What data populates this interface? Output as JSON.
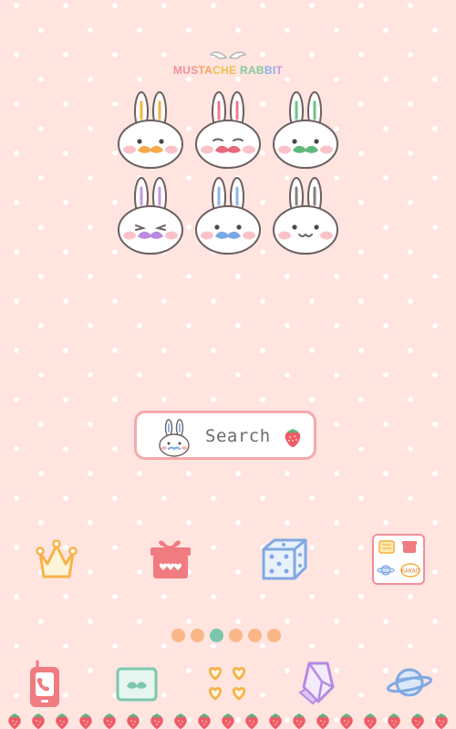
{
  "logo": {
    "title_letters": [
      "MUS",
      "TA",
      "CHE ",
      "RAB",
      "BI",
      "T"
    ]
  },
  "rabbits": [
    {
      "name": "rabbit-orange-mustache",
      "ear_color": "#f5b34a",
      "mustache": "#f5a94a"
    },
    {
      "name": "rabbit-red-mustache",
      "ear_color": "#f07b8c",
      "mustache": "#e8697a"
    },
    {
      "name": "rabbit-green-mustache",
      "ear_color": "#6fc28b",
      "mustache": "#5fb87c"
    },
    {
      "name": "rabbit-purple-mustache",
      "ear_color": "#c39ae6",
      "mustache": "#b98ae0"
    },
    {
      "name": "rabbit-blue-mustache",
      "ear_color": "#8db6ea",
      "mustache": "#7aa8e6"
    },
    {
      "name": "rabbit-plain",
      "ear_color": "#8a7f7d",
      "mustache": "none"
    }
  ],
  "search": {
    "label": "Search"
  },
  "dock": [
    "crown-icon",
    "gift-box-icon",
    "dice-icon",
    "widget-icon"
  ],
  "pager": {
    "count": 6,
    "active_index": 2
  },
  "bottom_bar": [
    "phone-icon",
    "mustache-card-icon",
    "hearts-icon",
    "eraser-icon",
    "planet-icon"
  ],
  "widget": {
    "chat_text": "KAKAO"
  },
  "colors": {
    "background": "#ffe4df",
    "accent_pink": "#f08f95",
    "accent_blue": "#7fa9e3",
    "accent_green": "#7dc6ae",
    "accent_orange": "#f9b787"
  }
}
